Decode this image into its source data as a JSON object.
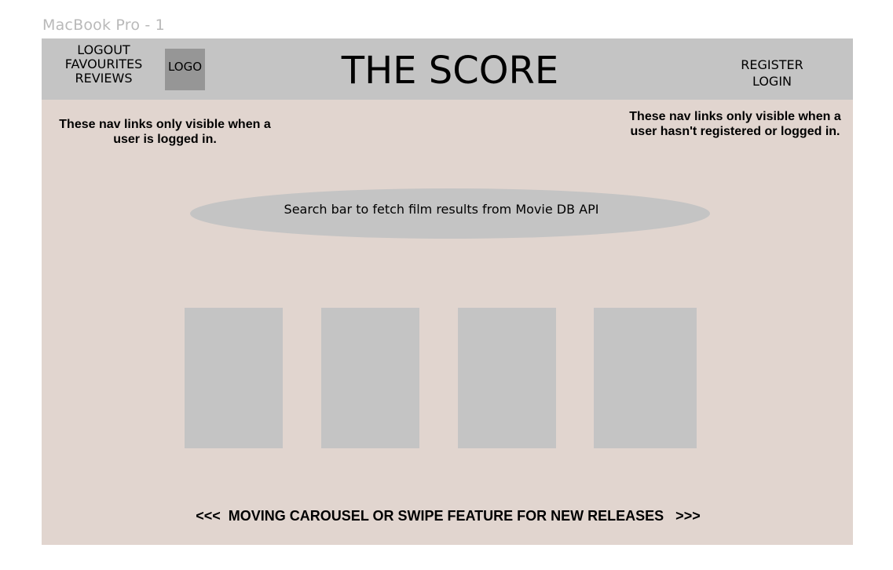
{
  "frame_label": "MacBook Pro - 1",
  "header": {
    "logged_in_nav": [
      "LOGOUT",
      "FAVOURITES",
      "REVIEWS"
    ],
    "logo_text": "LOGO",
    "title": "THE SCORE",
    "guest_nav": [
      "REGISTER",
      "LOGIN"
    ],
    "background": "#c4c4c4"
  },
  "notes": {
    "left": "These nav links only visible when a user is logged in.",
    "right": "These nav links only visible when a user hasn't registered or logged in."
  },
  "search": {
    "text": "Search bar to fetch film results from Movie DB API"
  },
  "carousel": {
    "text": "<<<  MOVING CAROUSEL OR SWIPE FEATURE FOR NEW RELEASES   >>>",
    "poster_count": 4
  },
  "colors": {
    "page_background": "#e1d5cf",
    "placeholder": "#c4c4c4",
    "logo_box": "#969696"
  }
}
